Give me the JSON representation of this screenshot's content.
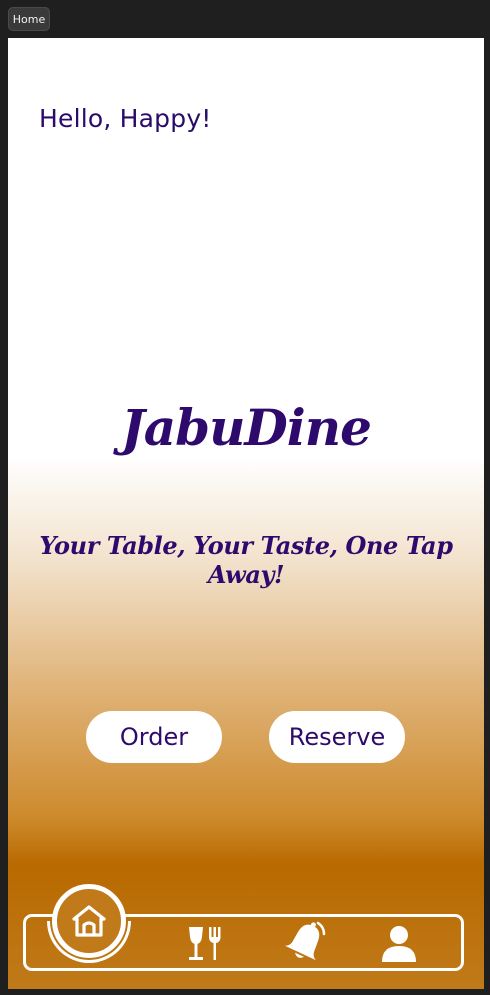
{
  "window": {
    "tab_label": "Home"
  },
  "header": {
    "greeting": "Hello, Happy!"
  },
  "hero": {
    "brand_name": "JabuDine",
    "tagline": "Your Table, Your Taste, One Tap Away!"
  },
  "actions": {
    "order_label": "Order",
    "reserve_label": "Reserve"
  },
  "nav": {
    "items": [
      {
        "icon": "home-icon",
        "active": true
      },
      {
        "icon": "dining-icon",
        "active": false
      },
      {
        "icon": "bell-icon",
        "active": false
      },
      {
        "icon": "user-icon",
        "active": false
      }
    ]
  },
  "colors": {
    "primary_text": "#2e0a6d",
    "accent": "#c07a1a",
    "surface": "#ffffff"
  }
}
